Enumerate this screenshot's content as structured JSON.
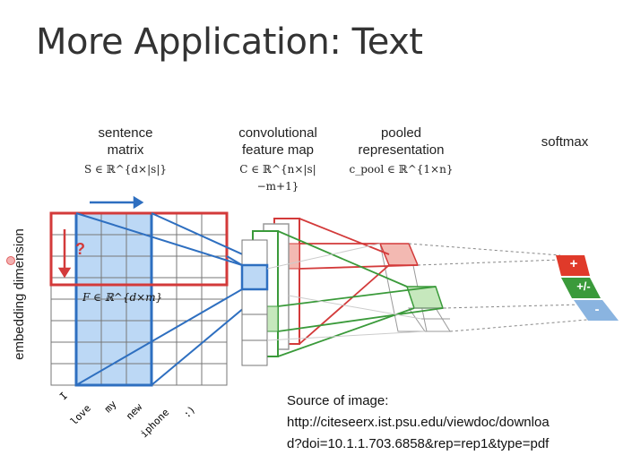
{
  "title": "More Application: Text",
  "columns": {
    "sentence": {
      "label_line1": "sentence",
      "label_line2": "matrix",
      "math": "S ∈ ℝ^{d×|s|}"
    },
    "conv": {
      "label_line1": "convolutional",
      "label_line2": "feature map",
      "math": "C ∈ ℝ^{n×|s|−m+1}"
    },
    "pooled": {
      "label_line1": "pooled",
      "label_line2": "representation",
      "math": "c_pool ∈ ℝ^{1×n}"
    },
    "softmax": {
      "label": "softmax"
    }
  },
  "y_axis_label": "embedding dimension",
  "filter_label": "F ∈ ℝ^{d×m}",
  "filter_mark": "?",
  "words": [
    "I",
    "love",
    "my",
    "new",
    "iphone",
    ":)"
  ],
  "softmax_outputs": [
    {
      "label": "+",
      "color": "#e03a2a"
    },
    {
      "label": "+/-",
      "color": "#3a9a3a"
    },
    {
      "label": "-",
      "color": "#8ab4e0"
    }
  ],
  "colors": {
    "blue": "#2e6fc0",
    "light_blue": "#bcd8f5",
    "red": "#d33a3a",
    "green": "#3a9a3a",
    "light_red": "#f3b9b2",
    "light_green": "#c6e8bd"
  },
  "source": {
    "line1": "Source of image:",
    "line2": "http://citeseerx.ist.psu.edu/viewdoc/downloa",
    "line3": "d?doi=10.1.1.703.6858&rep=rep1&type=pdf"
  }
}
